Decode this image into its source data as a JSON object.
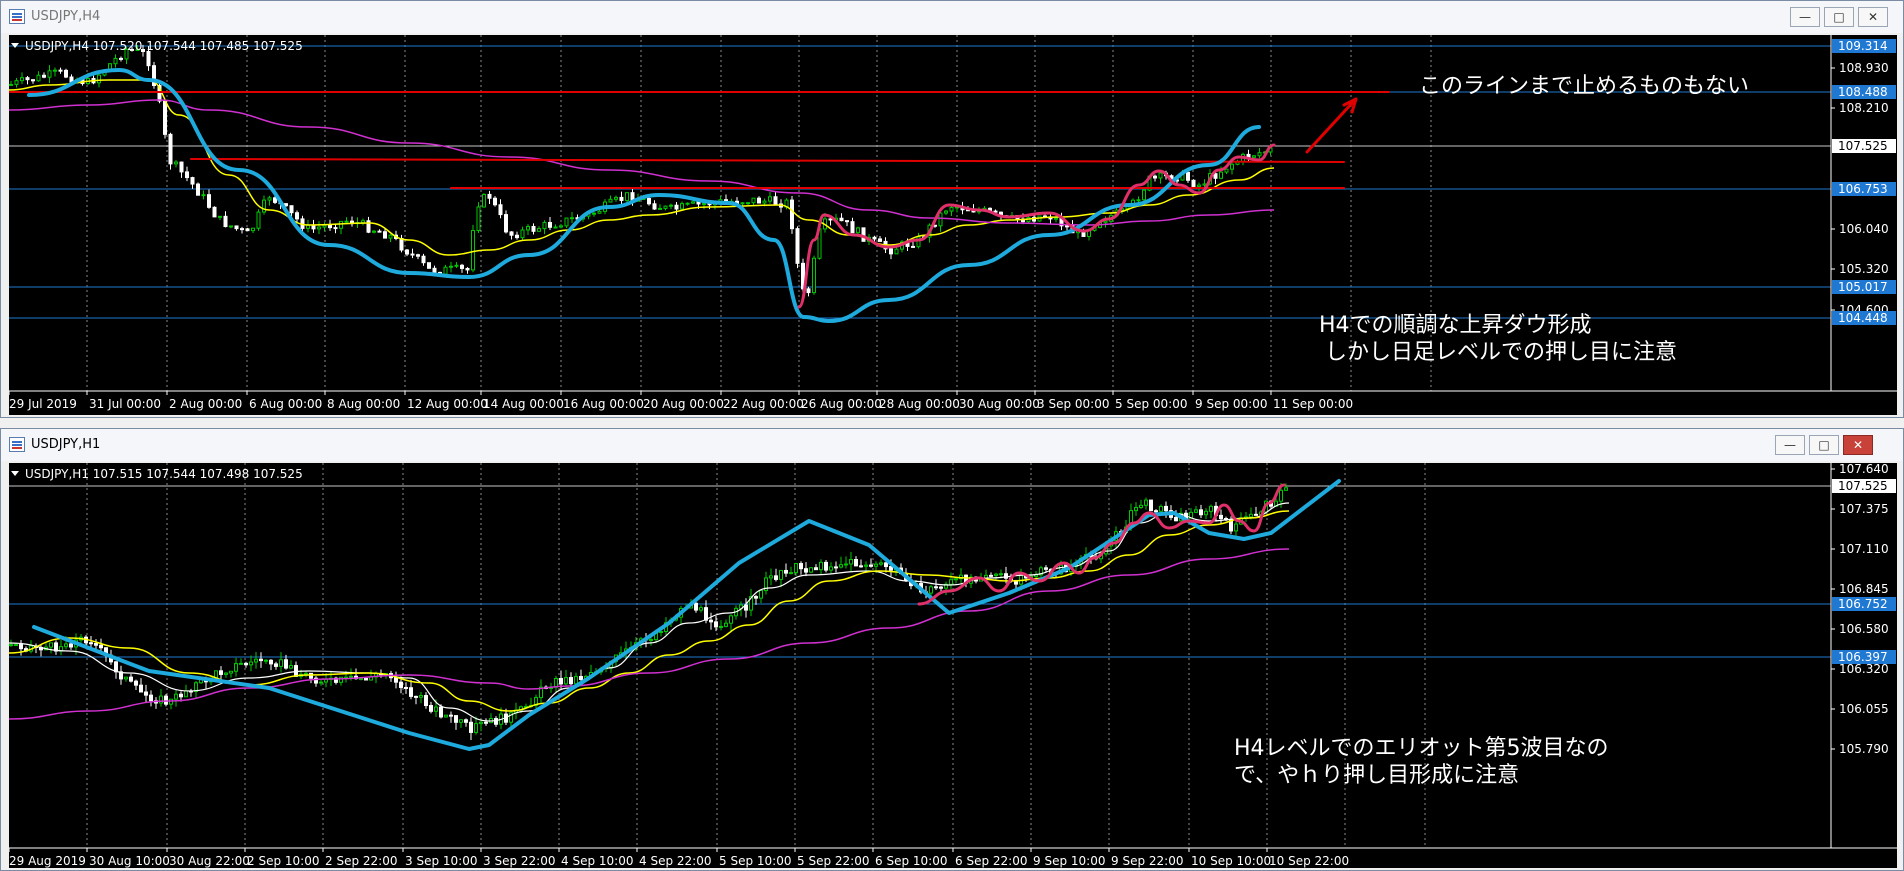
{
  "top": {
    "window_title": "USDJPY,H4",
    "info": "USDJPY,H4  107.520 107.544 107.485 107.525",
    "y_labels": [
      "108.930",
      "108.210",
      "106.040",
      "105.320",
      "104.600"
    ],
    "hlines": [
      {
        "label": "109.314",
        "color": "#1f78d1"
      },
      {
        "label": "108.488",
        "color": "#1f78d1"
      },
      {
        "label": "107.525",
        "color": "#c8c8c8"
      },
      {
        "label": "106.753",
        "color": "#1f78d1"
      },
      {
        "label": "105.017",
        "color": "#1f78d1"
      },
      {
        "label": "104.448",
        "color": "#1f78d1"
      }
    ],
    "x_labels": [
      "29 Jul 2019",
      "31 Jul 00:00",
      "2 Aug 00:00",
      "6 Aug 00:00",
      "8 Aug 00:00",
      "12 Aug 00:00",
      "14 Aug 00:00",
      "16 Aug 00:00",
      "20 Aug 00:00",
      "22 Aug 00:00",
      "26 Aug 00:00",
      "28 Aug 00:00",
      "30 Aug 00:00",
      "3 Sep 00:00",
      "5 Sep 00:00",
      "9 Sep 00:00",
      "11 Sep 00:00"
    ],
    "annotation_1": "このラインまで止めるものもない",
    "annotation_2": "H4での順調な上昇ダウ形成",
    "annotation_3": "しかし日足レベルでの押し目に注意"
  },
  "bottom": {
    "window_title": "USDJPY,H1",
    "info": "USDJPY,H1  107.515 107.544 107.498 107.525",
    "y_labels": [
      "107.640",
      "107.375",
      "107.110",
      "106.845",
      "106.580",
      "106.320",
      "106.055",
      "105.790"
    ],
    "hlines": [
      {
        "label": "107.525",
        "color": "#c8c8c8"
      },
      {
        "label": "106.752",
        "color": "#1f78d1"
      },
      {
        "label": "106.397",
        "color": "#1f78d1"
      }
    ],
    "x_labels": [
      "29 Aug 2019",
      "30 Aug 10:00",
      "30 Aug 22:00",
      "2 Sep 10:00",
      "2 Sep 22:00",
      "3 Sep 10:00",
      "3 Sep 22:00",
      "4 Sep 10:00",
      "4 Sep 22:00",
      "5 Sep 10:00",
      "5 Sep 22:00",
      "6 Sep 10:00",
      "6 Sep 22:00",
      "9 Sep 10:00",
      "9 Sep 22:00",
      "10 Sep 10:00",
      "10 Sep 22:00"
    ],
    "annotation_1": "H4レベルでのエリオット第5波目なの",
    "annotation_2": "で、やｈり押し目形成に注意"
  },
  "buttons": {
    "minimize": "—",
    "maximize": "□",
    "close": "✕"
  },
  "colors": {
    "bull": "#00c800",
    "bear": "#ffffff",
    "ma_fast": "#ffff00",
    "ma_slow": "#d030d0",
    "ma_white": "#ffffff",
    "trend_blue": "#1eaadc",
    "wave_red": "#e0306a",
    "resistance": "#e00000",
    "level_blue": "#1f78d1"
  }
}
